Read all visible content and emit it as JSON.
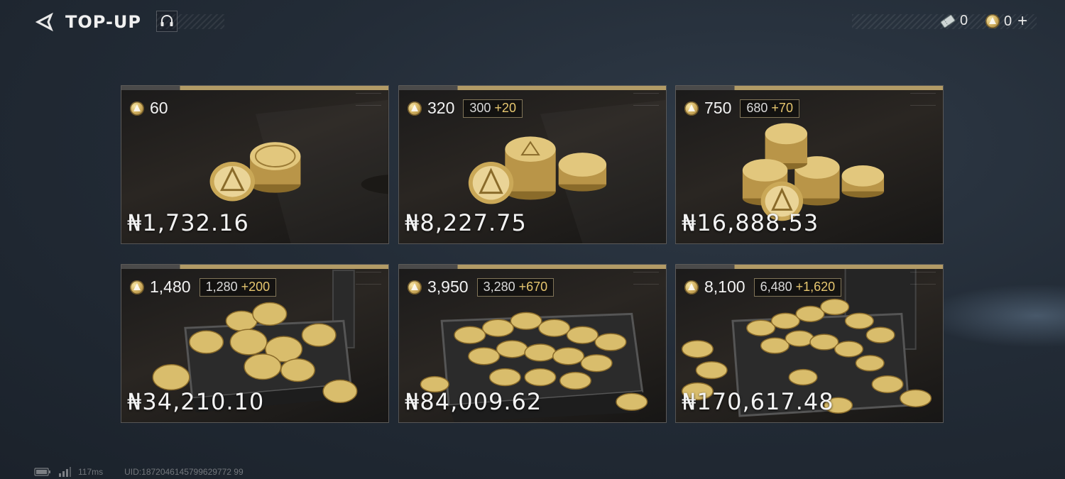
{
  "header": {
    "title": "TOP-UP",
    "back_icon": "back-arrow-icon",
    "support_icon": "headset-icon"
  },
  "currencies": {
    "tickets": "0",
    "coins": "0",
    "add_label": "+"
  },
  "packs": [
    {
      "amount": "60",
      "base": "",
      "bonus": "",
      "price": "₦1,732.16"
    },
    {
      "amount": "320",
      "base": "300",
      "bonus": "+20",
      "price": "₦8,227.75"
    },
    {
      "amount": "750",
      "base": "680",
      "bonus": "+70",
      "price": "₦16,888.53"
    },
    {
      "amount": "1,480",
      "base": "1,280",
      "bonus": "+200",
      "price": "₦34,210.10"
    },
    {
      "amount": "3,950",
      "base": "3,280",
      "bonus": "+670",
      "price": "₦84,009.62"
    },
    {
      "amount": "8,100",
      "base": "6,480",
      "bonus": "+1,620",
      "price": "₦170,617.48"
    }
  ],
  "footer": {
    "ping": "117ms",
    "uid": "UID:1872046145799629772 99"
  },
  "colors": {
    "gold": "#d3b262",
    "bonus_accent": "#e6c66f",
    "background": "#232c37"
  }
}
